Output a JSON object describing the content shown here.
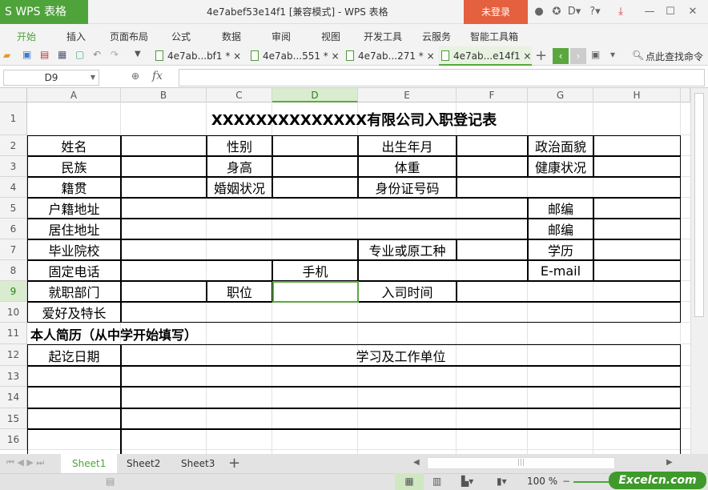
{
  "app": {
    "logo": "S WPS 表格",
    "title": "4e7abef53e14f1 [兼容模式] - WPS 表格",
    "login": "未登录",
    "window_icons": [
      "skin-icon",
      "settings-icon",
      "d-icon",
      "help-icon",
      "download-icon",
      "minimize-icon",
      "maximize-icon",
      "close-icon"
    ]
  },
  "menu": [
    "开始",
    "插入",
    "页面布局",
    "公式",
    "数据",
    "审阅",
    "视图",
    "开发工具",
    "云服务",
    "智能工具箱"
  ],
  "doc_tabs": [
    "4e7ab...bf1 * ×",
    "4e7ab...551 * ×",
    "4e7ab...271 * ×",
    "4e7ab...e14f1 ×"
  ],
  "search": "点此查找命令",
  "formula": {
    "namebox": "D9",
    "fx": "fx",
    "value": ""
  },
  "columns": [
    "A",
    "B",
    "C",
    "D",
    "E",
    "F",
    "G",
    "H"
  ],
  "rows": [
    "1",
    "2",
    "3",
    "4",
    "5",
    "6",
    "7",
    "8",
    "9",
    "10",
    "11",
    "12",
    "13",
    "14",
    "15",
    "16"
  ],
  "form": {
    "title": "XXXXXXXXXXXXXX有限公司入职登记表",
    "name": "姓名",
    "gender": "性别",
    "birth": "出生年月",
    "politics": "政治面貌",
    "ethnicity": "民族",
    "height": "身高",
    "weight": "体重",
    "health": "健康状况",
    "native": "籍贯",
    "marital": "婚姻状况",
    "idno": "身份证号码",
    "hukou": "户籍地址",
    "zip1": "邮编",
    "residence": "居住地址",
    "zip2": "邮编",
    "school": "毕业院校",
    "major": "专业或原工种",
    "education": "学历",
    "phone": "固定电话",
    "mobile": "手机",
    "email": "E-mail",
    "dept": "就职部门",
    "position": "职位",
    "joindate": "入司时间",
    "hobby": "爱好及特长",
    "resume": "本人简历（从中学开始填写）",
    "period": "起讫日期",
    "workplace": "学习及工作单位"
  },
  "sheets": [
    "Sheet1",
    "Sheet2",
    "Sheet3"
  ],
  "status": {
    "zoom": "100 %",
    "watermark": "Excelcn.com"
  }
}
